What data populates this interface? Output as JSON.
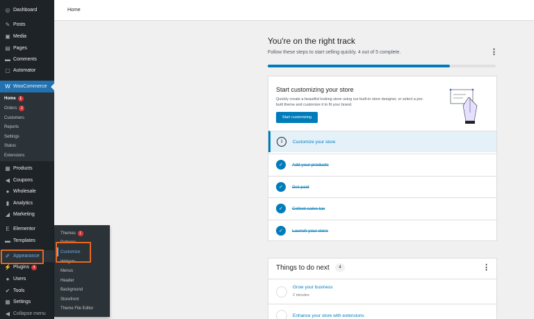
{
  "sidebar": {
    "items": [
      {
        "name": "dashboard",
        "label": "Dashboard",
        "icon": "gauge-icon",
        "glyph": "◎"
      },
      {
        "name": "posts",
        "label": "Posts",
        "icon": "pin-icon",
        "glyph": "✎"
      },
      {
        "name": "media",
        "label": "Media",
        "icon": "media-icon",
        "glyph": "▣"
      },
      {
        "name": "pages",
        "label": "Pages",
        "icon": "page-icon",
        "glyph": "▤"
      },
      {
        "name": "comments",
        "label": "Comments",
        "icon": "comment-icon",
        "glyph": "▬"
      },
      {
        "name": "automator",
        "label": "Automator",
        "icon": "automator-icon",
        "glyph": "▢"
      },
      {
        "name": "woocommerce",
        "label": "WooCommerce",
        "icon": "woo-icon",
        "glyph": "W"
      },
      {
        "name": "products",
        "label": "Products",
        "icon": "archive-icon",
        "glyph": "▦"
      },
      {
        "name": "coupons",
        "label": "Coupons",
        "icon": "megaphone-icon",
        "glyph": "◀"
      },
      {
        "name": "wholesale",
        "label": "Wholesale",
        "icon": "wholesale-icon",
        "glyph": "●"
      },
      {
        "name": "analytics",
        "label": "Analytics",
        "icon": "chart-bar-icon",
        "glyph": "▮"
      },
      {
        "name": "marketing",
        "label": "Marketing",
        "icon": "megaphone-icon",
        "glyph": "◢"
      },
      {
        "name": "elementor",
        "label": "Elementor",
        "icon": "elementor-icon",
        "glyph": "E"
      },
      {
        "name": "templates",
        "label": "Templates",
        "icon": "folder-icon",
        "glyph": "▬"
      },
      {
        "name": "appearance",
        "label": "Appearance",
        "icon": "paintbrush-icon",
        "glyph": "✐"
      },
      {
        "name": "plugins",
        "label": "Plugins",
        "icon": "plug-icon",
        "glyph": "⚡",
        "badge": "4"
      },
      {
        "name": "users",
        "label": "Users",
        "icon": "users-icon",
        "glyph": "●"
      },
      {
        "name": "tools",
        "label": "Tools",
        "icon": "wrench-icon",
        "glyph": "✔"
      },
      {
        "name": "settings",
        "label": "Settings",
        "icon": "settings-icon",
        "glyph": "▦"
      },
      {
        "name": "collapse",
        "label": "Collapse menu",
        "icon": "collapse-icon",
        "glyph": "◀"
      }
    ],
    "woo_submenu": [
      {
        "label": "Home",
        "badge": "1"
      },
      {
        "label": "Orders",
        "badge": "2"
      },
      {
        "label": "Customers"
      },
      {
        "label": "Reports"
      },
      {
        "label": "Settings"
      },
      {
        "label": "Status"
      },
      {
        "label": "Extensions"
      }
    ]
  },
  "flyout": {
    "items": [
      {
        "label": "Themes",
        "badge": "1"
      },
      {
        "label": "Patterns"
      },
      {
        "label": "Customize"
      },
      {
        "label": "Widgets"
      },
      {
        "label": "Menus"
      },
      {
        "label": "Header"
      },
      {
        "label": "Background"
      },
      {
        "label": "Storefront"
      },
      {
        "label": "Theme File Editor"
      }
    ]
  },
  "topbar": {
    "title": "Home"
  },
  "setup": {
    "title": "You're on the right track",
    "subtitle": "Follow these steps to start selling quickly. 4 out of 5 complete.",
    "progress_percent": 80,
    "kebab": "⋮"
  },
  "hero": {
    "title": "Start customizing your store",
    "description": "Quickly create a beautiful looking store using our built-in store designer, or select a pre-built theme and customize it to fit your brand.",
    "button": "Start customizing"
  },
  "tasks": [
    {
      "label": "Customize your store",
      "done": false,
      "step": "1"
    },
    {
      "label": "Add your products",
      "done": true
    },
    {
      "label": "Get paid",
      "done": true
    },
    {
      "label": "Collect sales tax",
      "done": true
    },
    {
      "label": "Launch your store",
      "done": true
    }
  ],
  "todo": {
    "title": "Things to do next",
    "count": "4",
    "kebab": "⋮",
    "items": [
      {
        "label": "Grow your business",
        "meta": "2 minutes"
      },
      {
        "label": "Enhance your store with extensions",
        "meta": ""
      }
    ]
  },
  "colors": {
    "accent": "#007cba",
    "wp_blue": "#2271b1",
    "sidebar": "#1d2327",
    "highlight": "#e8681f",
    "badge": "#d63638"
  }
}
